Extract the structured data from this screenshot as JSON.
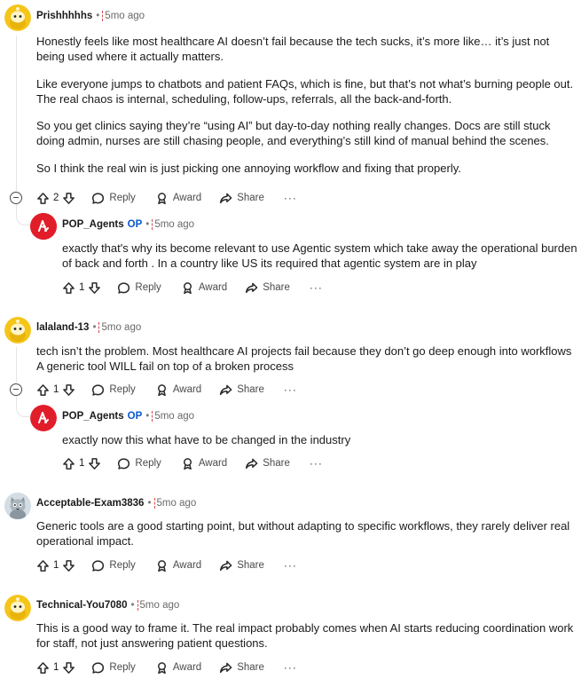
{
  "comments": [
    {
      "author": "Prishhhhhs",
      "time": "5mo ago",
      "paragraphs": [
        "Honestly feels like most healthcare AI doesn’t fail because the tech sucks, it’s more like… it’s just not being used where it actually matters.",
        "Like everyone jumps to chatbots and patient FAQs, which is fine, but that’s not what’s burning people out. The real chaos is internal, scheduling, follow-ups, referrals, all the back-and-forth.",
        "So you get clinics saying they’re “using AI” but day-to-day nothing really changes. Docs are still stuck doing admin, nurses are still chasing people, and everything’s still kind of manual behind the scenes.",
        "So I think the real win is just picking one annoying workflow and fixing that properly."
      ],
      "votes": "2",
      "reply_label": "Reply",
      "award_label": "Award",
      "share_label": "Share",
      "more": "···"
    },
    {
      "author": "POP_Agents",
      "op_badge": "OP",
      "time": "5mo ago",
      "paragraphs": [
        "exactly that's why its become relevant to use Agentic system which take away the operational burden of back and forth . In a country like US its required that agentic system are in play"
      ],
      "votes": "1",
      "reply_label": "Reply",
      "award_label": "Award",
      "share_label": "Share",
      "more": "···"
    },
    {
      "author": "lalaland-13",
      "time": "5mo ago",
      "paragraphs": [
        "tech isn’t the problem. Most healthcare AI projects fail because they don’t go deep enough into workflows A generic tool WILL fail on top of a broken process"
      ],
      "votes": "1",
      "reply_label": "Reply",
      "award_label": "Award",
      "share_label": "Share",
      "more": "···"
    },
    {
      "author": "POP_Agents",
      "op_badge": "OP",
      "time": "5mo ago",
      "paragraphs": [
        "exactly now this what have to be changed in the industry"
      ],
      "votes": "1",
      "reply_label": "Reply",
      "award_label": "Award",
      "share_label": "Share",
      "more": "···"
    },
    {
      "author": "Acceptable-Exam3836",
      "time": "5mo ago",
      "paragraphs": [
        "Generic tools are a good starting point, but without adapting to specific workflows, they rarely deliver real operational impact."
      ],
      "votes": "1",
      "reply_label": "Reply",
      "award_label": "Award",
      "share_label": "Share",
      "more": "···"
    },
    {
      "author": "Technical-You7080",
      "time": "5mo ago",
      "paragraphs": [
        "This is a good way to frame it. The real impact probably comes when AI starts reducing coordination work for staff, not just answering patient questions."
      ],
      "votes": "1",
      "reply_label": "Reply",
      "award_label": "Award",
      "share_label": "Share",
      "more": "···"
    }
  ],
  "colors": {
    "snoo_yellow": "#f5c518",
    "op_avatar_red": "#e11d2a",
    "op_badge_blue": "#0a58ca"
  },
  "icons": [
    "upvote-icon",
    "downvote-icon",
    "reply-icon",
    "award-icon",
    "share-icon",
    "collapse-icon",
    "more-icon"
  ]
}
